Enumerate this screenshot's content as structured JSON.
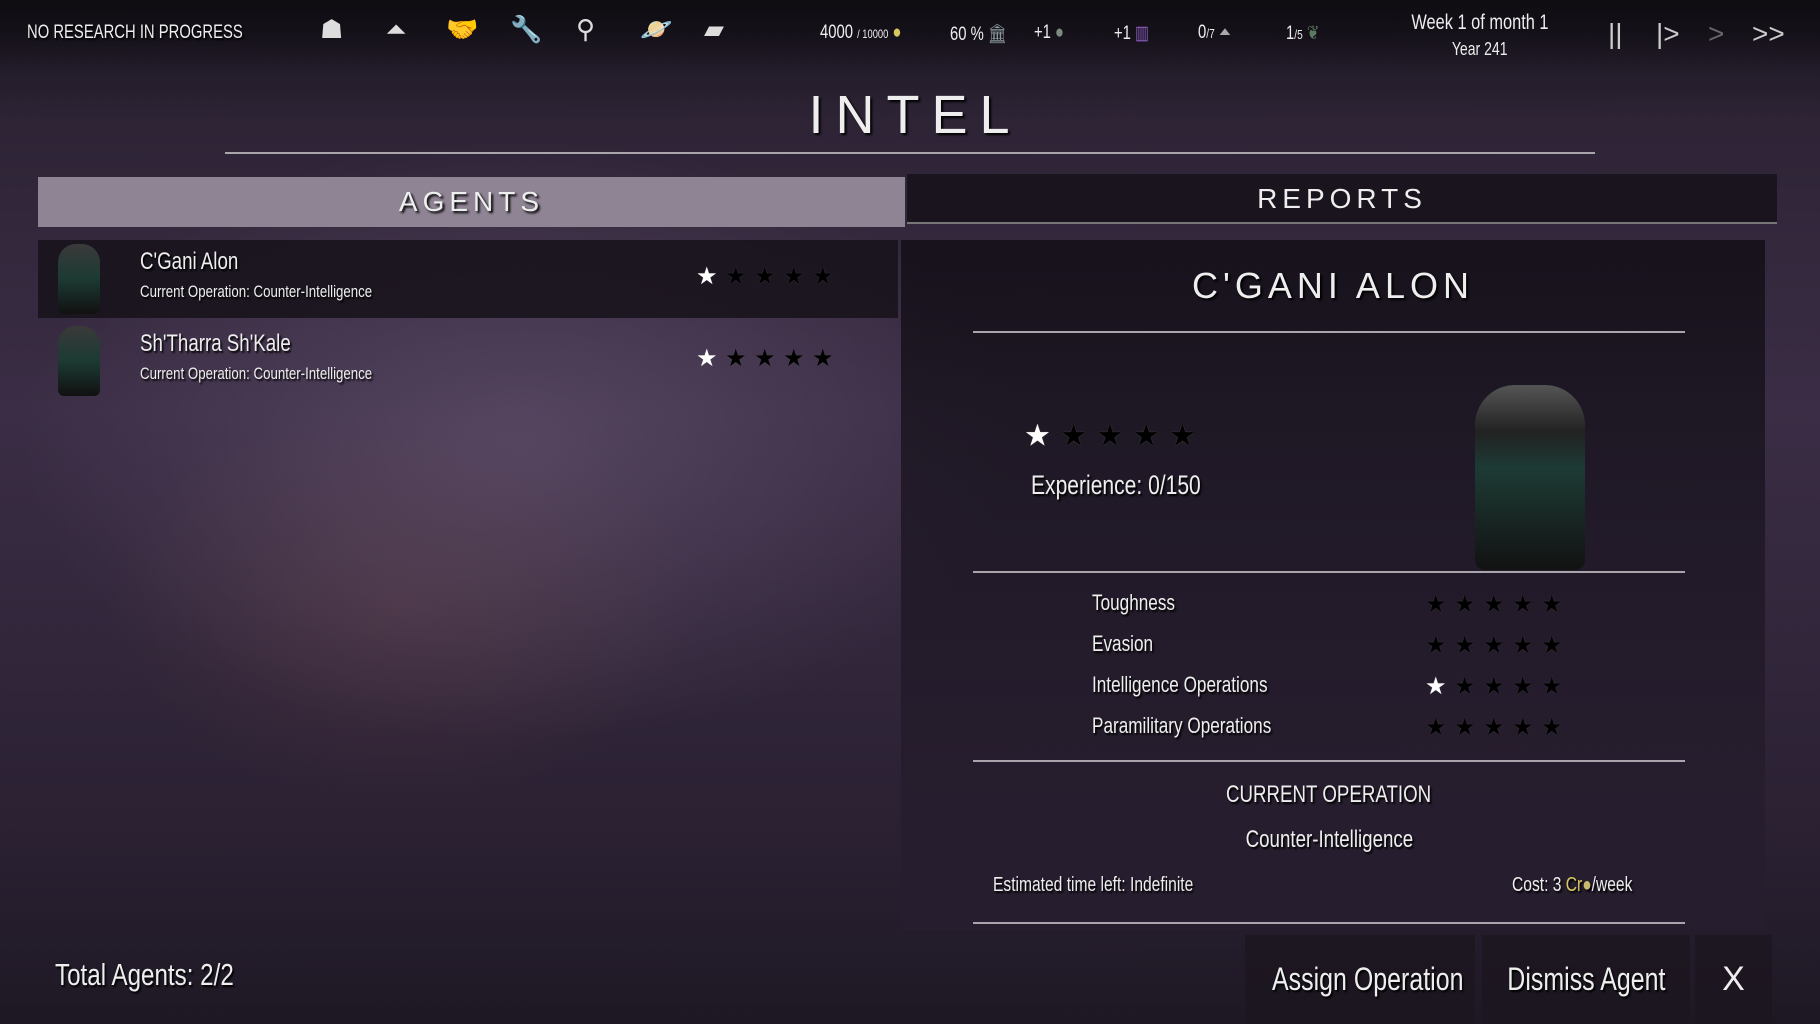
{
  "topbar": {
    "research_status": "NO RESEARCH IN PROGRESS",
    "nav_icons": [
      "population-icon",
      "research-flask-icon",
      "diplomacy-handshake-icon",
      "construction-tools-icon",
      "intel-magnifier-icon",
      "planet-icon",
      "encyclopedia-book-icon"
    ],
    "credits": "4000",
    "credits_max": "/ 10000",
    "approval": "60 %",
    "food": "+1",
    "industry": "+1",
    "science": "0",
    "science_max": "/7",
    "influence": "1",
    "influence_max": "/5",
    "date_line1": "Week 1 of month 1",
    "date_line2": "Year 241",
    "controls": {
      "pause": "||",
      "play": "|>",
      "speed": ">",
      "fast": ">>"
    }
  },
  "page_title": "INTEL",
  "tabs": {
    "agents": "AGENTS",
    "reports": "REPORTS",
    "active": "agents"
  },
  "agents": [
    {
      "name": "C'Gani Alon",
      "operation": "Current Operation: Counter-Intelligence",
      "rank": 1
    },
    {
      "name": "Sh'Tharra Sh'Kale",
      "operation": "Current Operation: Counter-Intelligence",
      "rank": 1
    }
  ],
  "detail": {
    "name": "C'GANI ALON",
    "rank": 1,
    "experience": "Experience: 0/150",
    "stats": [
      {
        "label": "Toughness",
        "value": 0
      },
      {
        "label": "Evasion",
        "value": 0
      },
      {
        "label": "Intelligence Operations",
        "value": 1
      },
      {
        "label": "Paramilitary Operations",
        "value": 0
      }
    ],
    "current_operation_heading": "CURRENT OPERATION",
    "current_operation": "Counter-Intelligence",
    "time_left": "Estimated time left: Indefinite",
    "cost_prefix": "Cost: 3 ",
    "cost_unit": "Cr",
    "cost_suffix": "/week"
  },
  "footer": {
    "total_agents": "Total Agents: 2/2",
    "assign": "Assign Operation",
    "dismiss": "Dismiss Agent",
    "close": "X"
  },
  "colors": {
    "credit": "#d8c860",
    "industry": "#8a5cc0"
  }
}
